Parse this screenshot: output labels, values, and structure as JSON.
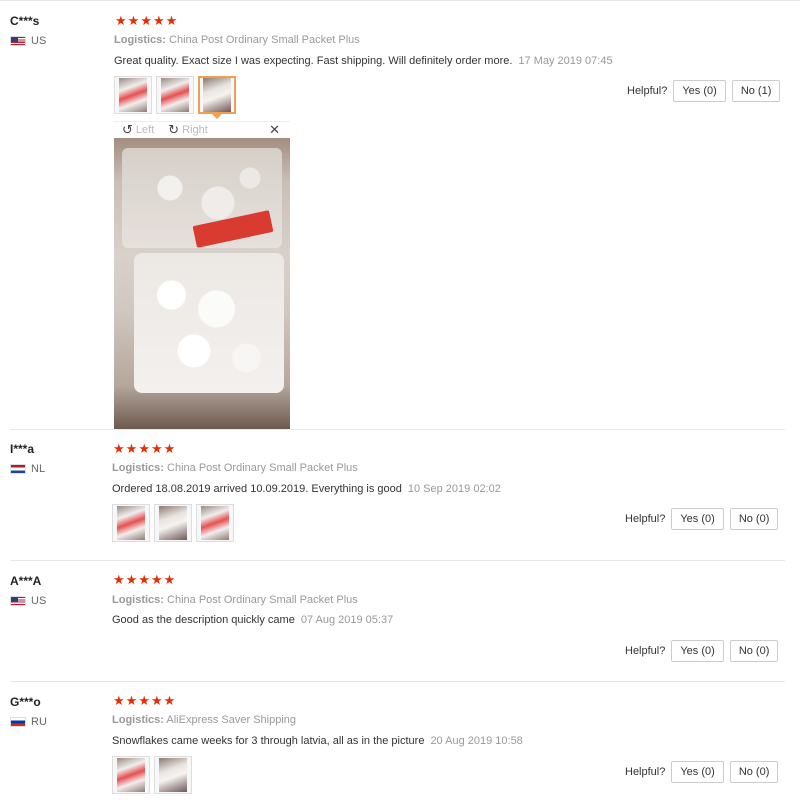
{
  "icons": {
    "star": "★",
    "rotate_left": "↺",
    "rotate_right": "↻",
    "close": "✕"
  },
  "viewer": {
    "left_label": "Left",
    "right_label": "Right"
  },
  "reviews": [
    {
      "user": "C***s",
      "country": "US",
      "logistics_label": "Logistics:",
      "logistics_value": "China Post Ordinary Small Packet Plus",
      "comment": "Great quality. Exact size I was expecting. Fast shipping. Will definitely order more.",
      "date": "17 May 2019 07:45",
      "helpful_label": "Helpful?",
      "yes_label": "Yes (0)",
      "no_label": "No (1)"
    },
    {
      "user": "I***a",
      "country": "NL",
      "logistics_label": "Logistics:",
      "logistics_value": "China Post Ordinary Small Packet Plus",
      "comment": "Ordered 18.08.2019 arrived 10.09.2019. Everything is good",
      "date": "10 Sep 2019 02:02",
      "helpful_label": "Helpful?",
      "yes_label": "Yes (0)",
      "no_label": "No (0)"
    },
    {
      "user": "A***A",
      "country": "US",
      "logistics_label": "Logistics:",
      "logistics_value": "China Post Ordinary Small Packet Plus",
      "comment": "Good as the description quickly came",
      "date": "07 Aug 2019 05:37",
      "helpful_label": "Helpful?",
      "yes_label": "Yes (0)",
      "no_label": "No (0)"
    },
    {
      "user": "G***o",
      "country": "RU",
      "logistics_label": "Logistics:",
      "logistics_value": "AliExpress Saver Shipping",
      "comment": "Snowflakes came weeks for 3 through latvia, all as in the picture",
      "date": "20 Aug 2019 10:58",
      "helpful_label": "Helpful?",
      "yes_label": "Yes (0)",
      "no_label": "No (0)"
    }
  ]
}
